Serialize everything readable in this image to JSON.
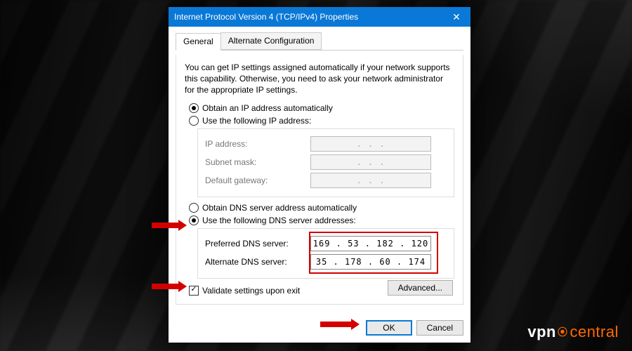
{
  "window": {
    "title": "Internet Protocol Version 4 (TCP/IPv4) Properties",
    "close_glyph": "✕"
  },
  "tabs": {
    "general": "General",
    "alternate": "Alternate Configuration"
  },
  "info_text": "You can get IP settings assigned automatically if your network supports this capability. Otherwise, you need to ask your network administrator for the appropriate IP settings.",
  "ip": {
    "auto_label": "Obtain an IP address automatically",
    "manual_label": "Use the following IP address:",
    "fields": {
      "ip_address": {
        "label": "IP address:",
        "value": ".   .   ."
      },
      "subnet": {
        "label": "Subnet mask:",
        "value": ".   .   ."
      },
      "gateway": {
        "label": "Default gateway:",
        "value": ".   .   ."
      }
    }
  },
  "dns": {
    "auto_label": "Obtain DNS server address automatically",
    "manual_label": "Use the following DNS server addresses:",
    "fields": {
      "preferred": {
        "label": "Preferred DNS server:",
        "value": "169 . 53 . 182 . 120"
      },
      "alternate": {
        "label": "Alternate DNS server:",
        "value": "35 . 178 . 60 . 174"
      }
    }
  },
  "validate_label": "Validate settings upon exit",
  "buttons": {
    "advanced": "Advanced...",
    "ok": "OK",
    "cancel": "Cancel"
  },
  "watermark": {
    "part1": "vpn",
    "part2": "central"
  }
}
